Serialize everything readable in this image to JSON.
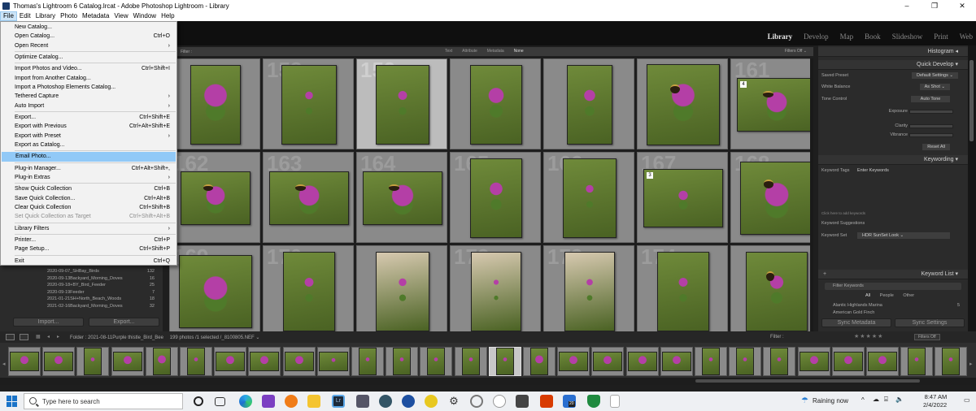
{
  "window": {
    "title": "Thomas's Lightroom 6 Catalog.lrcat - Adobe Photoshop Lightroom - Library",
    "controls": [
      "–",
      "❐",
      "✕"
    ]
  },
  "menubar": [
    "File",
    "Edit",
    "Library",
    "Photo",
    "Metadata",
    "View",
    "Window",
    "Help"
  ],
  "modules": [
    "Library",
    "Develop",
    "Map",
    "Book",
    "Slideshow",
    "Print",
    "Web"
  ],
  "file_menu": [
    {
      "label": "New Catalog...",
      "shortcut": ""
    },
    {
      "label": "Open Catalog...",
      "shortcut": "Ctrl+O"
    },
    {
      "label": "Open Recent",
      "shortcut": "›"
    },
    {
      "sep": true
    },
    {
      "label": "Optimize Catalog...",
      "shortcut": ""
    },
    {
      "sep": true
    },
    {
      "label": "Import Photos and Video...",
      "shortcut": "Ctrl+Shift+I"
    },
    {
      "label": "Import from Another Catalog...",
      "shortcut": ""
    },
    {
      "label": "Import a Photoshop Elements Catalog...",
      "shortcut": ""
    },
    {
      "label": "Tethered Capture",
      "shortcut": "›"
    },
    {
      "label": "Auto Import",
      "shortcut": "›"
    },
    {
      "sep": true
    },
    {
      "label": "Export...",
      "shortcut": "Ctrl+Shift+E"
    },
    {
      "label": "Export with Previous",
      "shortcut": "Ctrl+Alt+Shift+E"
    },
    {
      "label": "Export with Preset",
      "shortcut": "›"
    },
    {
      "label": "Export as Catalog...",
      "shortcut": ""
    },
    {
      "sep": true
    },
    {
      "label": "Email Photo...",
      "shortcut": "",
      "highlighted": true
    },
    {
      "sep": true
    },
    {
      "label": "Plug-in Manager...",
      "shortcut": "Ctrl+Alt+Shift+,"
    },
    {
      "label": "Plug-in Extras",
      "shortcut": "›"
    },
    {
      "sep": true
    },
    {
      "label": "Show Quick Collection",
      "shortcut": "Ctrl+B"
    },
    {
      "label": "Save Quick Collection...",
      "shortcut": "Ctrl+Alt+B"
    },
    {
      "label": "Clear Quick Collection",
      "shortcut": "Ctrl+Shift+B"
    },
    {
      "label": "Set Quick Collection as Target",
      "shortcut": "Ctrl+Shift+Alt+B",
      "disabled": true
    },
    {
      "sep": true
    },
    {
      "label": "Library Filters",
      "shortcut": "›"
    },
    {
      "sep": true
    },
    {
      "label": "Printer...",
      "shortcut": "Ctrl+P"
    },
    {
      "label": "Page Setup...",
      "shortcut": "Ctrl+Shift+P"
    },
    {
      "sep": true
    },
    {
      "label": "Exit",
      "shortcut": "Ctrl+Q"
    }
  ],
  "filter_bar": {
    "label": "Filter :",
    "tabs": [
      "Text",
      "Attribute",
      "Metadata",
      "None"
    ],
    "active": "None",
    "filters_off": "Filters Off ⌄"
  },
  "grid": {
    "rows": [
      [
        "",
        "158",
        "159",
        "",
        "",
        "",
        "161"
      ],
      [
        "162",
        "163",
        "164",
        "165",
        "166",
        "167",
        "168"
      ],
      [
        "169",
        "170",
        "",
        "172",
        "173",
        "174",
        ""
      ]
    ],
    "selected_index": 2
  },
  "folders": [
    {
      "name": "2020-09-07_SHBay_Birds",
      "count": "132"
    },
    {
      "name": "2020-09-13Backyard_Morning_Doves",
      "count": "16"
    },
    {
      "name": "2020-09-18+BY_Bird_Feeder",
      "count": "25"
    },
    {
      "name": "2020-09-19Feeder",
      "count": "7"
    },
    {
      "name": "2021-01-21SH+North_Beach_Woods",
      "count": "18"
    },
    {
      "name": "2021-02-16Backyard_Morning_Doves",
      "count": "32"
    }
  ],
  "left_buttons": {
    "import": "Import...",
    "export": "Export..."
  },
  "right_panel": {
    "histogram": "Histogram ◂",
    "quick_develop": "Quick Develop ▾",
    "saved_preset_label": "Saved Preset",
    "saved_preset_value": "Default Settings ⌄",
    "white_balance_label": "White Balance",
    "white_balance_value": "As Shot ⌄",
    "tone_control_label": "Tone Control",
    "auto_tone": "Auto Tone",
    "exposure": "Exposure",
    "clarity": "Clarity",
    "vibrance": "Vibrance",
    "reset_all": "Reset All",
    "keywording": "Keywording ▾",
    "keyword_tags_label": "Keyword Tags",
    "keyword_tags_value": "Enter Keywords",
    "click_add": "Click here to add keywords",
    "keyword_suggestions": "Keyword Suggestions",
    "keyword_set_label": "Keyword Set",
    "keyword_set_value": "HDR SunSet Look ⌄",
    "keyword_list": "Keyword List ▾",
    "plus": "+",
    "filter_keywords": "Filter Keywords",
    "kw_tabs": [
      "All",
      "People",
      "Other"
    ],
    "kw_items": [
      {
        "name": "Alantic Highlands Marina",
        "count": "5"
      },
      {
        "name": "American Gold Finch",
        "count": ""
      }
    ],
    "sync_metadata": "Sync Metadata",
    "sync_settings": "Sync Settings"
  },
  "toolbar": {
    "path": "Folder : 2021-08-11Purple thistle_Bird_Bee",
    "count": "199 photos /1 selected /_8100805.NEF ⌄",
    "filter": "Filter :",
    "stars": "★★★★★",
    "filters_off": "Filters Off"
  },
  "taskbar": {
    "search_placeholder": "Type here to search",
    "weather": "Raining now",
    "time": "8:47 AM",
    "date": "2/4/2022",
    "mail_count": "20"
  },
  "colors": {
    "accent": "#91c9f7",
    "thistle": "#b43fa6",
    "green": "#5b7a2e"
  }
}
